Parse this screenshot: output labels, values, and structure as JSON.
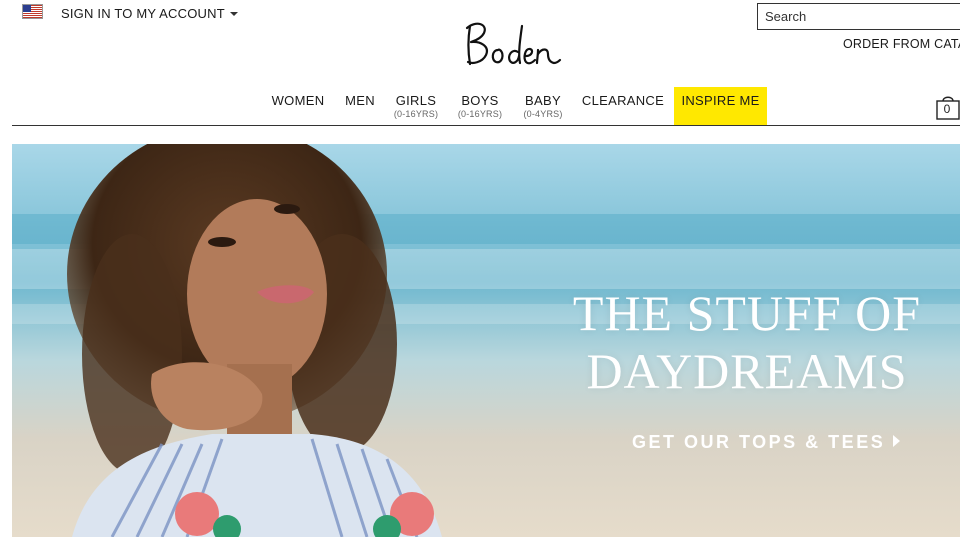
{
  "header": {
    "flag_icon": "us-flag-icon",
    "account_label": "SIGN IN TO MY ACCOUNT",
    "logo_text": "Boden",
    "search_placeholder": "Search",
    "order_label": "ORDER FROM CATA"
  },
  "nav": {
    "items": [
      {
        "label": "WOMEN",
        "sub": ""
      },
      {
        "label": "MEN",
        "sub": ""
      },
      {
        "label": "GIRLS",
        "sub": "(0-16YRS)"
      },
      {
        "label": "BOYS",
        "sub": "(0-16YRS)"
      },
      {
        "label": "BABY",
        "sub": "(0-4YRS)"
      },
      {
        "label": "CLEARANCE",
        "sub": ""
      },
      {
        "label": "INSPIRE ME",
        "sub": ""
      }
    ],
    "highlight_color": "#ffe800"
  },
  "bag": {
    "count": "0"
  },
  "hero": {
    "headline_line1": "THE STUFF OF",
    "headline_line2": "DAYDREAMS",
    "cta_label": "GET OUR TOPS & TEES"
  }
}
